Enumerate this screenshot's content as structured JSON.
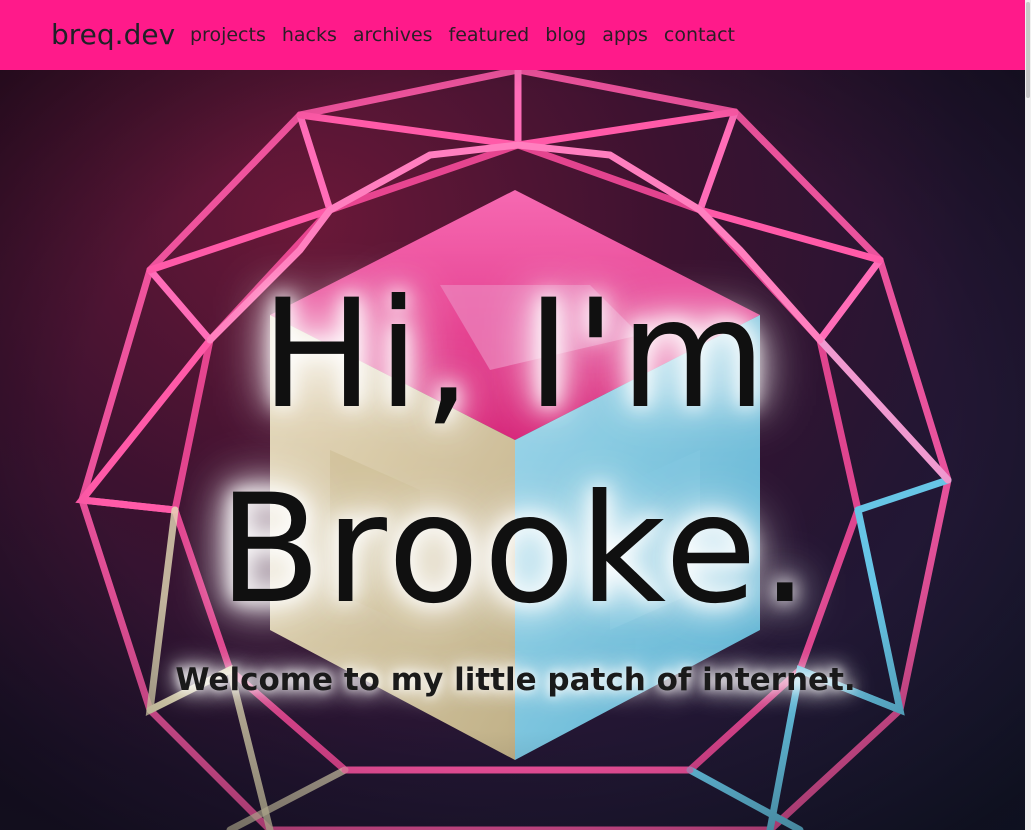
{
  "navbar": {
    "brand": "breq.dev",
    "links": [
      "projects",
      "hacks",
      "archives",
      "featured",
      "blog",
      "apps",
      "contact"
    ]
  },
  "hero": {
    "line1": "Hi, I'm",
    "line2": "Brooke.",
    "tagline": "Welcome to my little patch of internet."
  },
  "colors": {
    "navbar_bg": "#ff1a8a",
    "accent_pink": "#ff3d9e",
    "accent_blue": "#5ec8ea",
    "accent_cream": "#e6dcb8"
  }
}
